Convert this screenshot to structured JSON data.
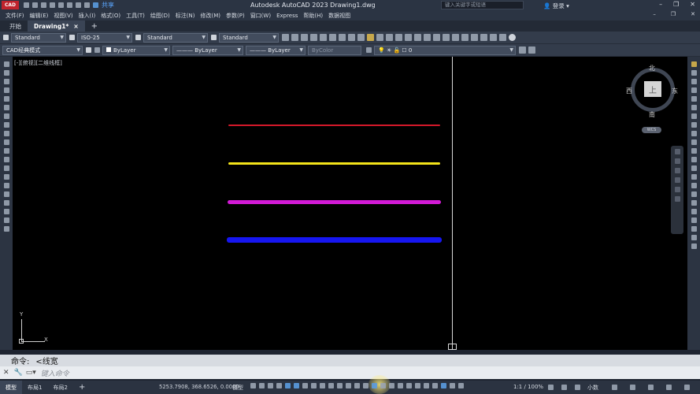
{
  "app": {
    "logo": "CAD",
    "title": "Autodesk AutoCAD 2023    Drawing1.dwg",
    "share": "共享",
    "search_placeholder": "键入关键字或短语",
    "login": "登录"
  },
  "menu": [
    "文件(F)",
    "编辑(E)",
    "视图(V)",
    "插入(I)",
    "格式(O)",
    "工具(T)",
    "绘图(D)",
    "标注(N)",
    "修改(M)",
    "参数(P)",
    "窗口(W)",
    "Express",
    "帮助(H)",
    "数据视图"
  ],
  "tabs": [
    {
      "label": "开始",
      "active": false
    },
    {
      "label": "Drawing1*",
      "active": true
    }
  ],
  "tab_close": "×",
  "tab_add": "+",
  "toolbar1": {
    "text_style": "Standard",
    "dim_style": "ISO-25",
    "table_style": "Standard",
    "mleader_style": "Standard"
  },
  "toolbar2": {
    "workspace": "CAD经典模式",
    "color": "ByLayer",
    "linetype": "ByLayer",
    "lineweight": "ByLayer",
    "plotstyle": "ByColor",
    "layer": "0"
  },
  "canvas": {
    "view_label": "[-][俯视][二维线框]",
    "lines": [
      {
        "color": "#d4192a",
        "weight": "thin"
      },
      {
        "color": "#f3e31a",
        "weight": "medium"
      },
      {
        "color": "#d31ad6",
        "weight": "thick"
      },
      {
        "color": "#1616f0",
        "weight": "heaviest"
      }
    ],
    "viewcube": {
      "face": "上",
      "north": "北",
      "south": "南",
      "east": "东",
      "west": "西",
      "wcs": "WCS"
    },
    "ucs": {
      "x": "X",
      "y": "Y"
    }
  },
  "command": {
    "history_prefix": "命令:",
    "history_text": "<线宽",
    "input_placeholder": "键入命令"
  },
  "statusbar": {
    "layout_tabs": [
      {
        "label": "模型",
        "active": true
      },
      {
        "label": "布局1",
        "active": false
      },
      {
        "label": "布局2",
        "active": false
      }
    ],
    "add_layout": "+",
    "coordinates": "5253.7908, 368.6526, 0.0000",
    "model_button": "模型",
    "scale": "1:1 / 100%",
    "units": "小数"
  }
}
